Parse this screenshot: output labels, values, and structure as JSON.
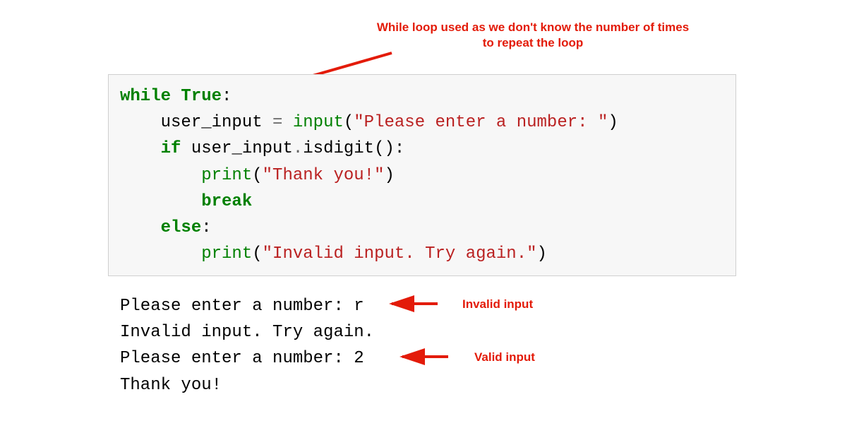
{
  "annotations": {
    "top": "While loop used as we don't know the number of times to repeat the loop",
    "invalid": "Invalid input",
    "valid": "Valid input"
  },
  "code": {
    "l1": {
      "kw1": "while",
      "sp1": " ",
      "kw2": "True",
      "colon": ":"
    },
    "l2": {
      "indent": "    ",
      "var": "user_input ",
      "op": "=",
      "sp": " ",
      "fn": "input",
      "paren1": "(",
      "str": "\"Please enter a number: \"",
      "paren2": ")"
    },
    "l3": {
      "indent": "    ",
      "kw": "if",
      "sp": " ",
      "expr": "user_input",
      "dot": ".",
      "method": "isdigit():"
    },
    "l4": {
      "indent": "        ",
      "fn": "print",
      "paren1": "(",
      "str": "\"Thank you!\"",
      "paren2": ")"
    },
    "l5": {
      "indent": "        ",
      "kw": "break"
    },
    "l6": {
      "indent": "    ",
      "kw": "else",
      "colon": ":"
    },
    "l7": {
      "indent": "        ",
      "fn": "print",
      "paren1": "(",
      "str": "\"Invalid input. Try again.\"",
      "paren2": ")"
    }
  },
  "output": {
    "l1": "Please enter a number: r",
    "l2": "Invalid input. Try again.",
    "l3": "Please enter a number: 2",
    "l4": "Thank you!"
  }
}
